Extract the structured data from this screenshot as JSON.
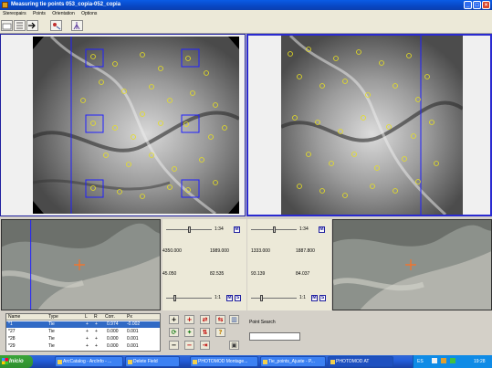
{
  "window": {
    "title": "Measuring tie points 053_copia-052_copia"
  },
  "menu": [
    "Stereopairs",
    "Points",
    "Orientation",
    "Options"
  ],
  "toolbar": {
    "icons": [
      "open-icon",
      "list-icon",
      "next-icon",
      "measure-icon",
      "tripod-icon"
    ]
  },
  "controls": {
    "left": {
      "zoom_top": "1:34",
      "zoom_bottom": "1:1",
      "x": "4350.000",
      "y": "1989.000",
      "a": "45.050",
      "b": "82.535",
      "m_label": "M",
      "s_label": "S"
    },
    "right": {
      "zoom_top": "1:34",
      "zoom_bottom": "1:1",
      "x": "1333.000",
      "y": "1887.800",
      "a": "93.139",
      "b": "84.037",
      "m_label": "M",
      "s_label": "S"
    }
  },
  "table": {
    "headers": [
      "Name",
      "Type",
      "L",
      "R",
      "Corr.",
      "Px"
    ],
    "rows": [
      {
        "name": "*1",
        "type": "Tie",
        "l": "+",
        "r": "+",
        "corr": "0.974",
        "px": "-0.002",
        "selected": true
      },
      {
        "name": "*27",
        "type": "Tie",
        "l": "+",
        "r": "+",
        "corr": "0.000",
        "px": "0.001",
        "selected": false
      },
      {
        "name": "*28",
        "type": "Tie",
        "l": "+",
        "r": "+",
        "corr": "0.000",
        "px": "0.001",
        "selected": false
      },
      {
        "name": "*29",
        "type": "Tie",
        "l": "+",
        "r": "+",
        "corr": "0.000",
        "px": "0.001",
        "selected": false
      }
    ]
  },
  "point_search": {
    "label": "Point Search",
    "value": ""
  },
  "taskbar": {
    "start": "Inicio",
    "tasks": [
      "ArcCatalog - ArcInfo - ...",
      "Delete Field",
      "PHOTOMOD Montage...",
      "Tie_points_Ajuste - P...",
      "PHOTOMOD AT"
    ],
    "tray_lang": "ES",
    "clock": "19:28"
  }
}
